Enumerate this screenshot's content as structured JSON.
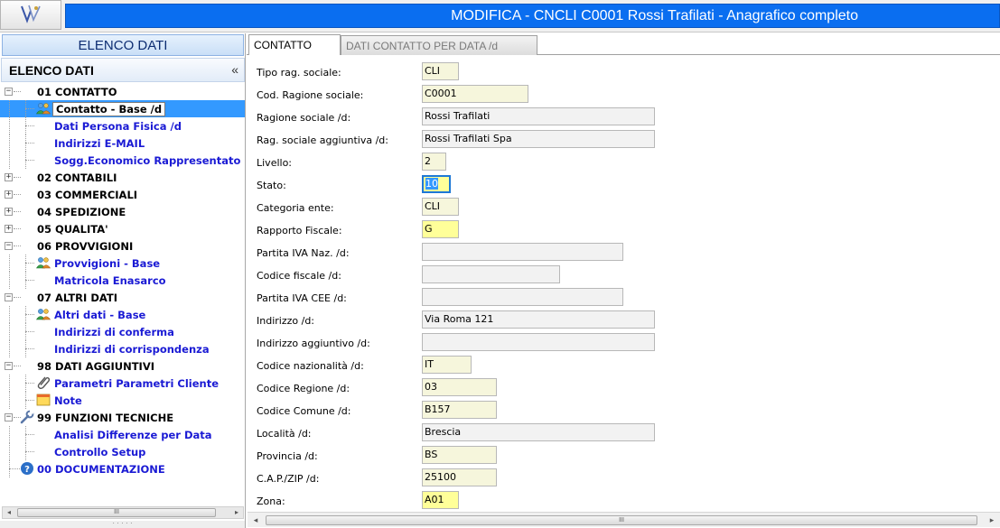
{
  "window": {
    "title": "MODIFICA - CNCLI C0001 Rossi Trafilati - Anagrafico completo",
    "logo_icon": "logo-check-icon"
  },
  "left": {
    "button_label": "ELENCO DATI",
    "tree_title": "ELENCO DATI",
    "collapse_glyph": "«",
    "rows": [
      {
        "label": "01 CONTATTO",
        "kind": "cat",
        "expander": "−",
        "icon": ""
      },
      {
        "label": "Contatto - Base /d",
        "kind": "item",
        "icon": "users-icon",
        "selected": true
      },
      {
        "label": "Dati Persona Fisica /d",
        "kind": "item",
        "icon": ""
      },
      {
        "label": "Indirizzi E-MAIL",
        "kind": "item",
        "icon": ""
      },
      {
        "label": "Sogg.Economico Rappresentato",
        "kind": "item",
        "icon": ""
      },
      {
        "label": "02 CONTABILI",
        "kind": "cat",
        "expander": "+",
        "icon": ""
      },
      {
        "label": "03 COMMERCIALI",
        "kind": "cat",
        "expander": "+",
        "icon": ""
      },
      {
        "label": "04 SPEDIZIONE",
        "kind": "cat",
        "expander": "+",
        "icon": ""
      },
      {
        "label": "05 QUALITA'",
        "kind": "cat",
        "expander": "+",
        "icon": ""
      },
      {
        "label": "06 PROVVIGIONI",
        "kind": "cat",
        "expander": "−",
        "icon": ""
      },
      {
        "label": "Provvigioni - Base",
        "kind": "item",
        "icon": "users-icon"
      },
      {
        "label": "Matricola Enasarco",
        "kind": "item",
        "icon": ""
      },
      {
        "label": "07 ALTRI DATI",
        "kind": "cat",
        "expander": "−",
        "icon": ""
      },
      {
        "label": "Altri dati - Base",
        "kind": "item",
        "icon": "users-icon"
      },
      {
        "label": "Indirizzi di conferma",
        "kind": "item",
        "icon": ""
      },
      {
        "label": "Indirizzi di corrispondenza",
        "kind": "item",
        "icon": ""
      },
      {
        "label": "98 DATI AGGIUNTIVI",
        "kind": "cat",
        "expander": "−",
        "icon": ""
      },
      {
        "label": "Parametri Parametri Cliente",
        "kind": "item",
        "icon": "paperclip-icon"
      },
      {
        "label": "Note",
        "kind": "item",
        "icon": "note-icon"
      },
      {
        "label": "99 FUNZIONI TECNICHE",
        "kind": "cat",
        "expander": "−",
        "icon": "wrench-icon"
      },
      {
        "label": "Analisi Differenze per Data",
        "kind": "item",
        "icon": ""
      },
      {
        "label": "Controllo Setup",
        "kind": "item",
        "icon": ""
      },
      {
        "label": "00 DOCUMENTAZIONE",
        "kind": "doc",
        "icon": "help-icon"
      }
    ]
  },
  "tabs": [
    {
      "label": "CONTATTO",
      "active": true
    },
    {
      "label": "DATI CONTATTO PER DATA /d",
      "active": false
    }
  ],
  "form": {
    "fields": [
      {
        "label": "Tipo rag. sociale:",
        "value": "CLI",
        "style": "cream"
      },
      {
        "label": "Cod. Ragione sociale:",
        "value": "C0001",
        "style": "cream"
      },
      {
        "label": "Ragione sociale /d:",
        "value": "Rossi Trafilati",
        "style": "grey"
      },
      {
        "label": "Rag. sociale aggiuntiva /d:",
        "value": "Rossi Trafilati Spa",
        "style": "grey"
      },
      {
        "label": "Livello:",
        "value": "2",
        "style": "cream"
      },
      {
        "label": "Stato:",
        "value": "10",
        "style": "yellow",
        "focused": true
      },
      {
        "label": "Categoria ente:",
        "value": "CLI",
        "style": "cream"
      },
      {
        "label": "Rapporto Fiscale:",
        "value": "G",
        "style": "yellow"
      },
      {
        "label": "Partita IVA Naz. /d:",
        "value": "",
        "style": "grey"
      },
      {
        "label": "Codice fiscale /d:",
        "value": "",
        "style": "grey"
      },
      {
        "label": "Partita IVA CEE /d:",
        "value": "",
        "style": "grey"
      },
      {
        "label": "Indirizzo /d:",
        "value": "Via Roma 121",
        "style": "grey"
      },
      {
        "label": "Indirizzo aggiuntivo /d:",
        "value": "",
        "style": "grey"
      },
      {
        "label": "Codice nazionalità /d:",
        "value": "IT",
        "style": "cream"
      },
      {
        "label": "Codice Regione /d:",
        "value": "03",
        "style": "cream"
      },
      {
        "label": "Codice Comune /d:",
        "value": "B157",
        "style": "cream"
      },
      {
        "label": "Località /d:",
        "value": "Brescia",
        "style": "grey"
      },
      {
        "label": "Provincia /d:",
        "value": "BS",
        "style": "cream"
      },
      {
        "label": "C.A.P./ZIP /d:",
        "value": "25100",
        "style": "cream"
      },
      {
        "label": "Zona:",
        "value": "A01",
        "style": "yellow"
      }
    ]
  },
  "scrollbars": {
    "grip": "III",
    "left_arrow": "◂",
    "right_arrow": "▸"
  }
}
